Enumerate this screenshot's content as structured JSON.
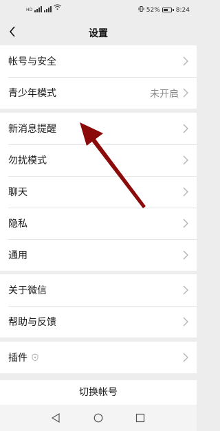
{
  "status_bar": {
    "carrier_info": "HD",
    "battery_percent": "52%",
    "time": "8:24"
  },
  "nav": {
    "title": "设置"
  },
  "groups": [
    {
      "items": [
        {
          "label": "帐号与安全",
          "value": ""
        },
        {
          "label": "青少年模式",
          "value": "未开启"
        }
      ]
    },
    {
      "items": [
        {
          "label": "新消息提醒",
          "value": ""
        },
        {
          "label": "勿扰模式",
          "value": ""
        },
        {
          "label": "聊天",
          "value": ""
        },
        {
          "label": "隐私",
          "value": ""
        },
        {
          "label": "通用",
          "value": ""
        }
      ]
    },
    {
      "items": [
        {
          "label": "关于微信",
          "value": ""
        },
        {
          "label": "帮助与反馈",
          "value": ""
        }
      ]
    },
    {
      "items": [
        {
          "label": "插件",
          "value": ""
        }
      ]
    }
  ],
  "switch_account_label": "切换帐号",
  "icons": {
    "back": "back-chevron-icon",
    "chevron": "chevron-right-icon",
    "plugin": "shield-icon",
    "annotation": "red-arrow-icon",
    "sys_back": "triangle-back-icon",
    "sys_home": "circle-home-icon",
    "sys_recent": "square-recent-icon"
  },
  "colors": {
    "background": "#ededed",
    "cell": "#ffffff",
    "annotation_arrow": "#8b0a0a"
  }
}
